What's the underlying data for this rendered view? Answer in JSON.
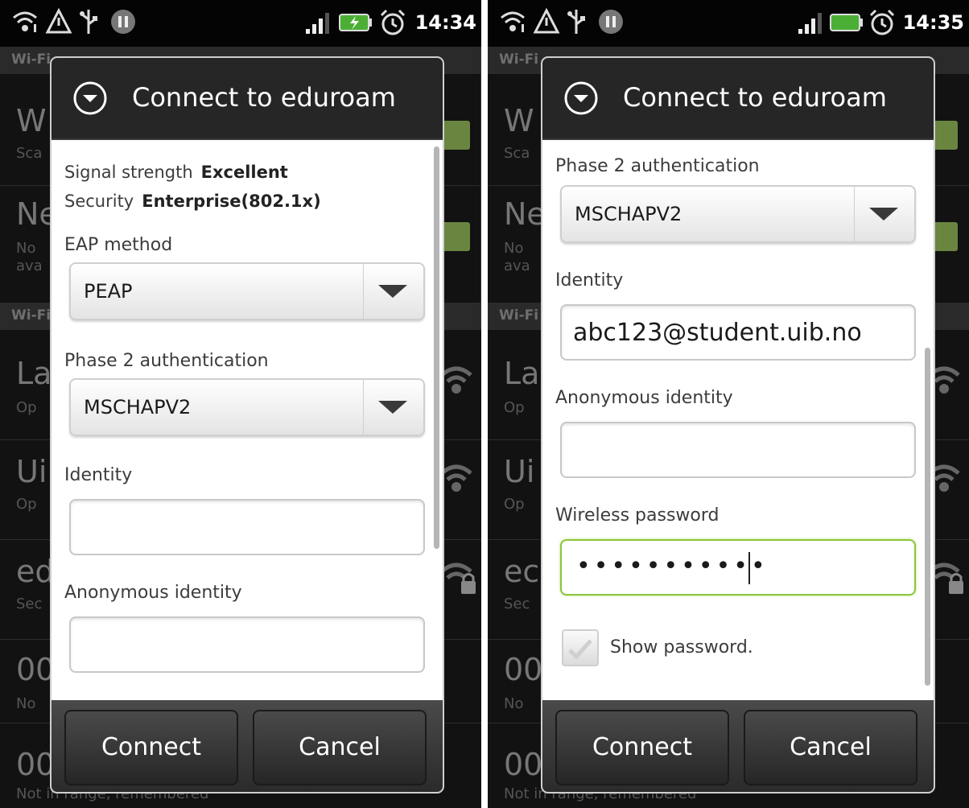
{
  "left": {
    "status": {
      "time": "14:34"
    },
    "background": {
      "section1": "Wi-Fi",
      "section2": "Wi-Fi",
      "items": [
        {
          "title": "W",
          "sub": "Sca"
        },
        {
          "title": "Ne",
          "sub": "No ava"
        },
        {
          "title": "La",
          "sub": "Op"
        },
        {
          "title": "Ui",
          "sub": "Op"
        },
        {
          "title": "ed",
          "sub": "Sec"
        },
        {
          "title": "00",
          "sub": "No"
        },
        {
          "title": "00",
          "sub": "Not in range, remembered"
        }
      ]
    },
    "dialog": {
      "title": "Connect to eduroam",
      "signal_label": "Signal strength",
      "signal_value": "Excellent",
      "security_label": "Security",
      "security_value": "Enterprise(802.1x)",
      "eap_label": "EAP method",
      "eap_value": "PEAP",
      "phase2_label": "Phase 2 authentication",
      "phase2_value": "MSCHAPV2",
      "identity_label": "Identity",
      "identity_value": "",
      "anon_label": "Anonymous identity",
      "anon_value": "",
      "connect_label": "Connect",
      "cancel_label": "Cancel"
    }
  },
  "right": {
    "status": {
      "time": "14:35"
    },
    "background": {
      "section1": "Wi-Fi",
      "section2": "Wi-Fi",
      "items": [
        {
          "title": "W",
          "sub": "Sca"
        },
        {
          "title": "Ne",
          "sub": "No ava"
        },
        {
          "title": "La",
          "sub": "Op"
        },
        {
          "title": "Ui",
          "sub": "Op"
        },
        {
          "title": "ec",
          "sub": "Sec"
        },
        {
          "title": "00",
          "sub": "No"
        },
        {
          "title": "00",
          "sub": "Not in range, remembered"
        }
      ]
    },
    "dialog": {
      "title": "Connect to eduroam",
      "phase2_label": "Phase 2 authentication",
      "phase2_value": "MSCHAPV2",
      "identity_label": "Identity",
      "identity_value": "abc123@student.uib.no",
      "anon_label": "Anonymous identity",
      "anon_value": "",
      "password_label": "Wireless password",
      "password_value": "•••••••••••",
      "show_password_label": "Show password.",
      "connect_label": "Connect",
      "cancel_label": "Cancel"
    }
  }
}
